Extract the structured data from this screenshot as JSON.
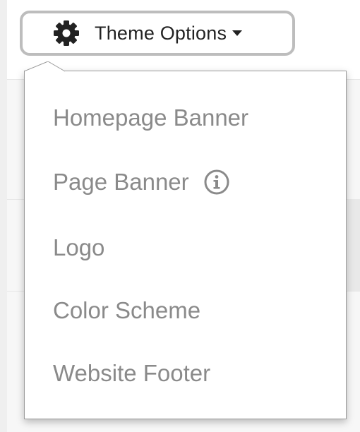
{
  "toolbar": {
    "theme_options_label": "Theme Options",
    "settings_icon": "gear-icon",
    "caret_icon": "caret-down-icon"
  },
  "menu": {
    "items": [
      {
        "label": "Homepage Banner"
      },
      {
        "label": "Page Banner",
        "icon": "info-icon"
      },
      {
        "label": "Logo"
      },
      {
        "label": "Color Scheme"
      },
      {
        "label": "Website Footer"
      }
    ]
  },
  "colors": {
    "button_border": "#bdbdbd",
    "menu_text": "#8a8a8a",
    "button_text": "#222222"
  }
}
